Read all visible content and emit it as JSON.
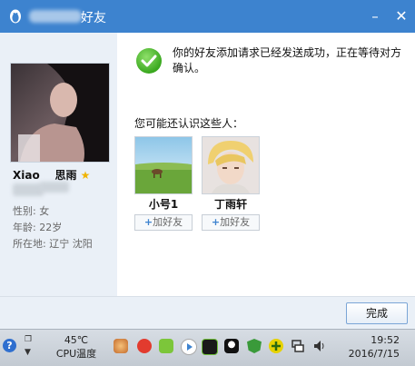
{
  "window": {
    "title": "好友",
    "minimize_label": "–",
    "close_label": "✕"
  },
  "profile": {
    "name_en": "Xiao",
    "name_cn": "思雨",
    "star": "★",
    "gender": "性别: 女",
    "age": "年龄: 22岁",
    "location": "所在地: 辽宁  沈阳"
  },
  "message": {
    "text": "你的好友添加请求已经发送成功，正在等待对方确认。",
    "suggest_label": "您可能还认识这些人："
  },
  "suggestions": [
    {
      "name": "小号1",
      "add_label": "加好友"
    },
    {
      "name": "丁雨轩",
      "add_label": "加好友"
    }
  ],
  "footer": {
    "done_label": "完成"
  },
  "taskbar": {
    "help": "?",
    "temp_value": "45℃",
    "temp_label": "CPU温度",
    "time": "19:52",
    "date": "2016/7/15"
  },
  "colors": {
    "title_bar": "#3d83cf",
    "accent_green": "#3aa81f"
  }
}
